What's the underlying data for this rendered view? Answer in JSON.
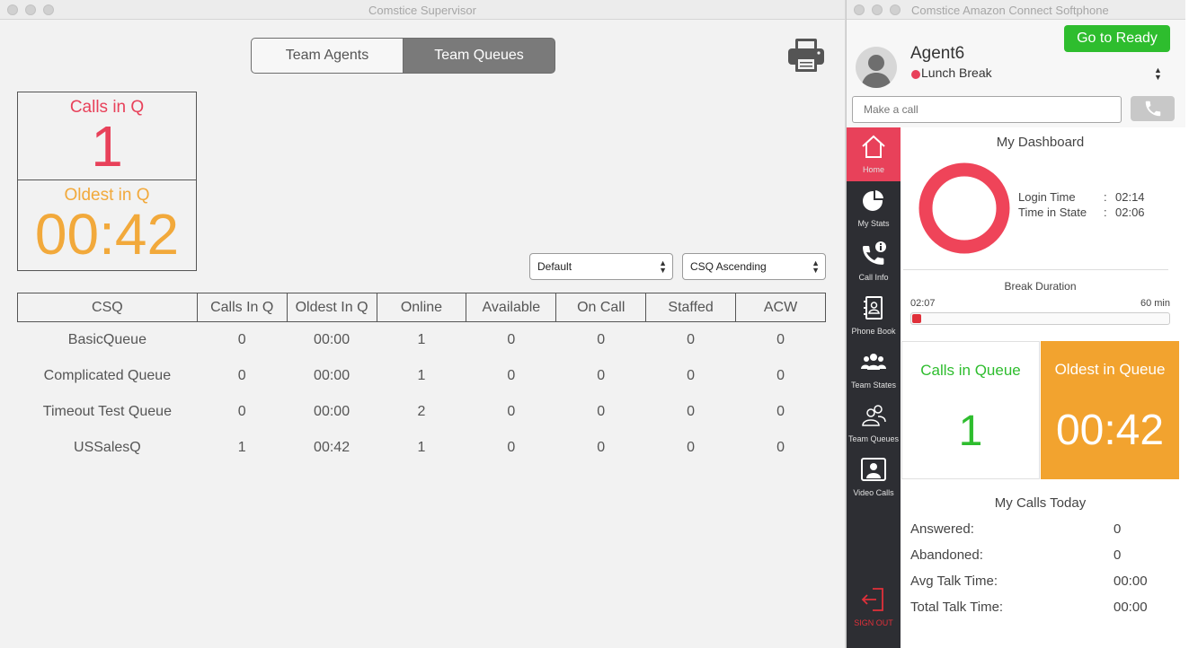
{
  "supervisor": {
    "window_title": "Comstice Supervisor",
    "tabs": [
      {
        "label": "Team Agents",
        "active": false
      },
      {
        "label": "Team Queues",
        "active": true
      }
    ],
    "summary": {
      "calls_label": "Calls in Q",
      "calls_value": "1",
      "oldest_label": "Oldest in Q",
      "oldest_value": "00:42"
    },
    "filter_select": "Default",
    "sort_select": "CSQ Ascending",
    "table": {
      "headers": [
        "CSQ",
        "Calls In Q",
        "Oldest In Q",
        "Online",
        "Available",
        "On Call",
        "Staffed",
        "ACW"
      ],
      "rows": [
        [
          "BasicQueue",
          "0",
          "00:00",
          "1",
          "0",
          "0",
          "0",
          "0"
        ],
        [
          "Complicated Queue",
          "0",
          "00:00",
          "1",
          "0",
          "0",
          "0",
          "0"
        ],
        [
          "Timeout Test Queue",
          "0",
          "00:00",
          "2",
          "0",
          "0",
          "0",
          "0"
        ],
        [
          "USSalesQ",
          "1",
          "00:42",
          "1",
          "0",
          "0",
          "0",
          "0"
        ]
      ]
    }
  },
  "softphone": {
    "window_title": "Comstice Amazon Connect Softphone",
    "agent_name": "Agent6",
    "status": "Lunch Break",
    "ready_button": "Go to Ready",
    "make_call_placeholder": "Make a call",
    "nav": [
      {
        "label": "Home",
        "icon": "home-icon",
        "active": true
      },
      {
        "label": "My Stats",
        "icon": "pie-chart-icon",
        "active": false
      },
      {
        "label": "Call Info",
        "icon": "phone-info-icon",
        "active": false
      },
      {
        "label": "Phone Book",
        "icon": "phone-book-icon",
        "active": false
      },
      {
        "label": "Team States",
        "icon": "team-icon",
        "active": false
      },
      {
        "label": "Team Queues",
        "icon": "team-queues-icon",
        "active": false
      },
      {
        "label": "Video Calls",
        "icon": "video-call-icon",
        "active": false
      }
    ],
    "signout_label": "SIGN OUT",
    "dashboard": {
      "title": "My Dashboard",
      "login_time_label": "Login Time",
      "login_time_value": "02:14",
      "time_in_state_label": "Time in State",
      "time_in_state_value": "02:06",
      "break_title": "Break Duration",
      "break_elapsed": "02:07",
      "break_limit": "60 min",
      "break_progress": 0.035,
      "calls_in_queue_label": "Calls in Queue",
      "calls_in_queue_value": "1",
      "oldest_in_queue_label": "Oldest in Queue",
      "oldest_in_queue_value": "00:42",
      "today_title": "My Calls Today",
      "today": [
        {
          "label": "Answered:",
          "value": "0"
        },
        {
          "label": "Abandoned:",
          "value": "0"
        },
        {
          "label": "Avg Talk Time:",
          "value": "00:00"
        },
        {
          "label": "Total Talk Time:",
          "value": "00:00"
        }
      ]
    },
    "colors": {
      "red": "#e8415a",
      "green": "#2ebd2e",
      "orange": "#f2a32f",
      "nav_bg": "#2d2e33"
    }
  }
}
